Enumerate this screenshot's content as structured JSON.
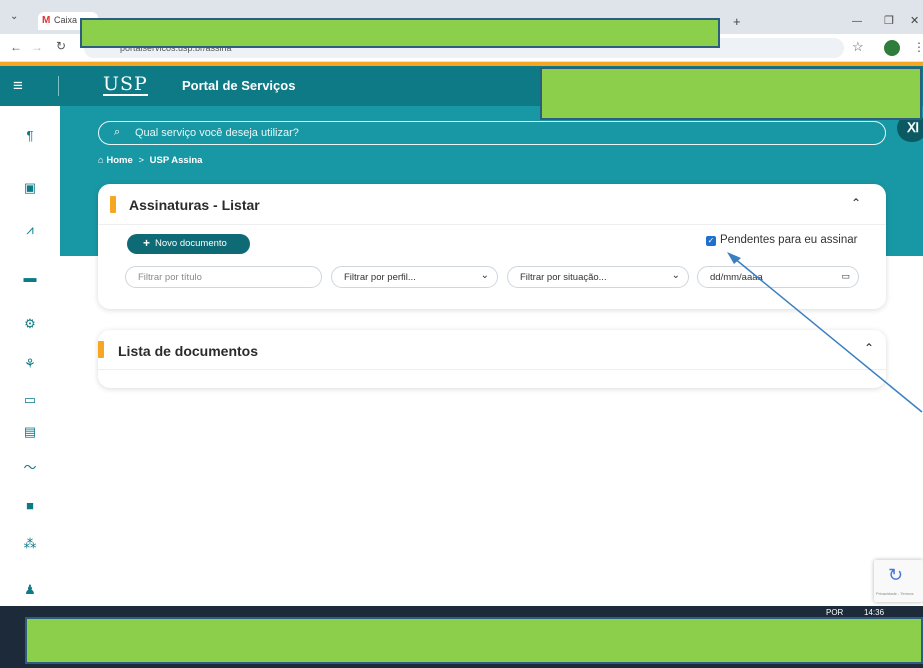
{
  "browser": {
    "tab_title": "Caixa",
    "url": "portalservicos.usp.br/assina",
    "new_tab": "+",
    "window_minimize": "—",
    "window_restore": "❐",
    "window_close": "✕"
  },
  "header": {
    "logo_text": "USP",
    "title": "Portal de Serviços",
    "menu_glyph": "≡"
  },
  "search": {
    "placeholder": "Qual serviço você deseja utilizar?"
  },
  "breadcrumb": {
    "home": "Home",
    "separator": ">",
    "current": "USP Assina"
  },
  "assinaturas_card": {
    "title": "Assinaturas - Listar",
    "new_button": "Novo documento",
    "checkbox_label": "Pendentes para eu assinar",
    "checkbox_checked": true,
    "filters": {
      "titulo_placeholder": "Filtrar por título",
      "perfil_placeholder": "Filtrar por perfil...",
      "situacao_placeholder": "Filtrar por situação...",
      "date_placeholder": "dd/mm/aaaa"
    }
  },
  "documentos_card": {
    "title": "Lista de documentos"
  },
  "sidebar": {
    "icons": [
      "restaurant-icon",
      "id-card-icon",
      "chart-icon",
      "briefcase-icon",
      "people-gear-icon",
      "hand-icon",
      "credit-card-icon",
      "building-icon",
      "signature-icon",
      "book-icon",
      "org-chart-icon",
      "user-icon"
    ]
  },
  "taskbar": {
    "lang": "POR",
    "time": "14:36"
  },
  "recaptcha": {
    "text": "Privacidade - Termos"
  },
  "colors": {
    "teal_dark": "#0e7a86",
    "teal_band": "#1898a4",
    "accent_orange": "#f5a623",
    "highlight_green": "#8ccf4a",
    "annotation_arrow": "#3a7fc0"
  }
}
